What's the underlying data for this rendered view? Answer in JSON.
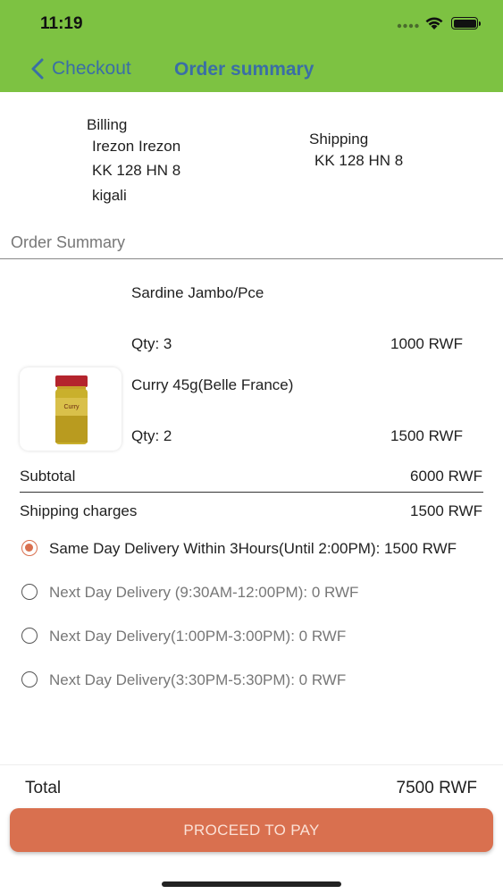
{
  "status_bar": {
    "time": "11:19"
  },
  "nav": {
    "back_label": "Checkout",
    "title": "Order summary"
  },
  "billing": {
    "label": "Billing",
    "lines": [
      "Irezon Irezon",
      "KK 128 HN 8",
      "kigali"
    ]
  },
  "shipping": {
    "label": "Shipping",
    "lines": [
      "KK 128 HN 8"
    ]
  },
  "order_summary": {
    "title": "Order Summary",
    "items": [
      {
        "name": "Sardine Jambo/Pce",
        "qty": "Qty: 3",
        "price": "1000 RWF"
      },
      {
        "name": "Curry 45g(Belle France)",
        "qty": "Qty: 2",
        "price": "1500 RWF",
        "thumb_label": "Curry"
      }
    ],
    "subtotal_label": "Subtotal",
    "subtotal_value": "6000 RWF",
    "shipping_label": "Shipping charges",
    "shipping_value": "1500 RWF"
  },
  "delivery_options": [
    {
      "label": "Same Day Delivery Within 3Hours(Until 2:00PM): 1500 RWF",
      "selected": true
    },
    {
      "label": "Next Day Delivery (9:30AM-12:00PM): 0 RWF",
      "selected": false
    },
    {
      "label": "Next Day Delivery(1:00PM-3:00PM): 0 RWF",
      "selected": false
    },
    {
      "label": "Next Day Delivery(3:30PM-5:30PM): 0 RWF",
      "selected": false
    }
  ],
  "total": {
    "label": "Total",
    "value": "7500 RWF"
  },
  "pay_button": {
    "label": "PROCEED TO PAY"
  },
  "colors": {
    "header": "#7dc242",
    "accent": "#d9704f",
    "nav_text": "#3a6ea6"
  }
}
